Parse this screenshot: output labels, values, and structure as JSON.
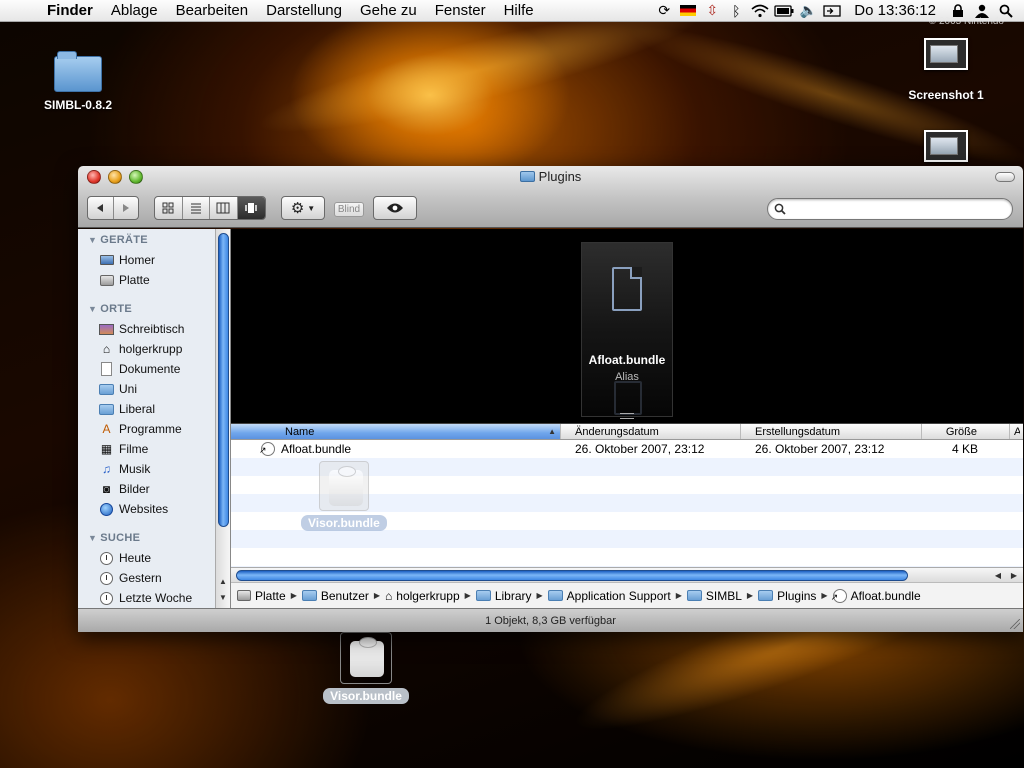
{
  "menubar": {
    "apple_icon": "apple-icon",
    "items": [
      "Finder",
      "Ablage",
      "Bearbeiten",
      "Darstellung",
      "Gehe zu",
      "Fenster",
      "Hilfe"
    ],
    "clock": "Do 13:36:12",
    "status_icons": [
      "sync-icon",
      "flag-de-icon",
      "input-icon",
      "bluetooth-icon",
      "wifi-icon",
      "battery-icon",
      "volume-icon",
      "display-icon",
      "lock-icon",
      "user-icon",
      "spotlight-icon"
    ]
  },
  "desktop": {
    "copyright": "© 2005 Nintendo",
    "folder_label": "SIMBL-0.8.2",
    "screenshot_label": "Screenshot 1",
    "bundle_label": "Visor.bundle"
  },
  "window": {
    "title": "Plugins",
    "toolbar": {
      "blind_label": "Blind",
      "search_value": "",
      "search_placeholder": ""
    },
    "sidebar": {
      "sections": [
        {
          "title": "GERÄTE",
          "items": [
            {
              "label": "Homer",
              "icon": "laptop-icon"
            },
            {
              "label": "Platte",
              "icon": "drive-icon"
            }
          ]
        },
        {
          "title": "ORTE",
          "items": [
            {
              "label": "Schreibtisch",
              "icon": "desktop-icon"
            },
            {
              "label": "holgerkrupp",
              "icon": "home-icon"
            },
            {
              "label": "Dokumente",
              "icon": "document-icon"
            },
            {
              "label": "Uni",
              "icon": "folder-icon"
            },
            {
              "label": "Liberal",
              "icon": "folder-icon"
            },
            {
              "label": "Programme",
              "icon": "applications-icon"
            },
            {
              "label": "Filme",
              "icon": "movies-icon"
            },
            {
              "label": "Musik",
              "icon": "music-icon"
            },
            {
              "label": "Bilder",
              "icon": "camera-icon"
            },
            {
              "label": "Websites",
              "icon": "globe-icon"
            }
          ]
        },
        {
          "title": "SUCHE",
          "items": [
            {
              "label": "Heute",
              "icon": "clock-icon"
            },
            {
              "label": "Gestern",
              "icon": "clock-icon"
            },
            {
              "label": "Letzte Woche",
              "icon": "clock-icon"
            }
          ]
        }
      ]
    },
    "coverflow": {
      "title": "Afloat.bundle",
      "subtitle": "Alias"
    },
    "list": {
      "columns": [
        "Name",
        "Änderungsdatum",
        "Erstellungsdatum",
        "Größe",
        "A"
      ],
      "rows": [
        {
          "name": "Afloat.bundle",
          "modified": "26. Oktober 2007, 23:12",
          "created": "26. Oktober 2007, 23:12",
          "size": "4 KB"
        }
      ],
      "drag_label": "Visor.bundle"
    },
    "path": [
      "Platte",
      "Benutzer",
      "holgerkrupp",
      "Library",
      "Application Support",
      "SIMBL",
      "Plugins",
      "Afloat.bundle"
    ],
    "status": "1 Objekt, 8,3 GB verfügbar"
  }
}
